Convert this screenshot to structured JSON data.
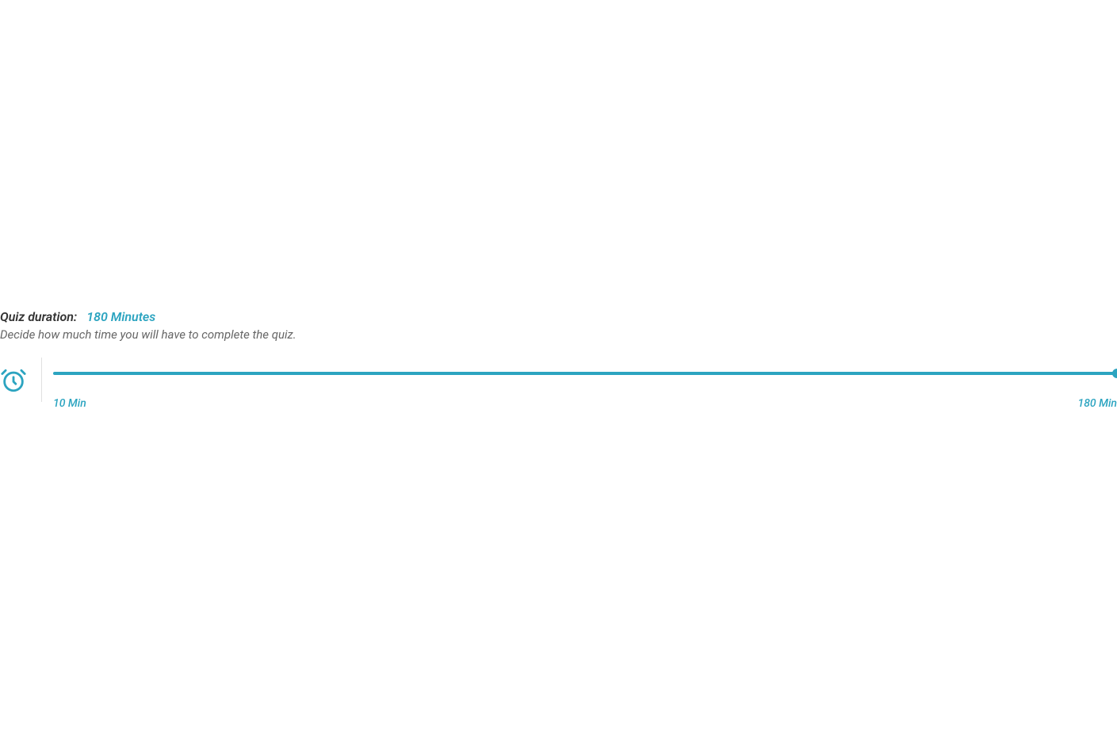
{
  "duration": {
    "label": "Quiz duration:",
    "value": "180 Minutes",
    "description": "Decide how much time you will have to complete the quiz.",
    "minLabel": "10 Min",
    "maxLabel": "180 Min"
  },
  "colors": {
    "accent": "#2CA4C0"
  }
}
